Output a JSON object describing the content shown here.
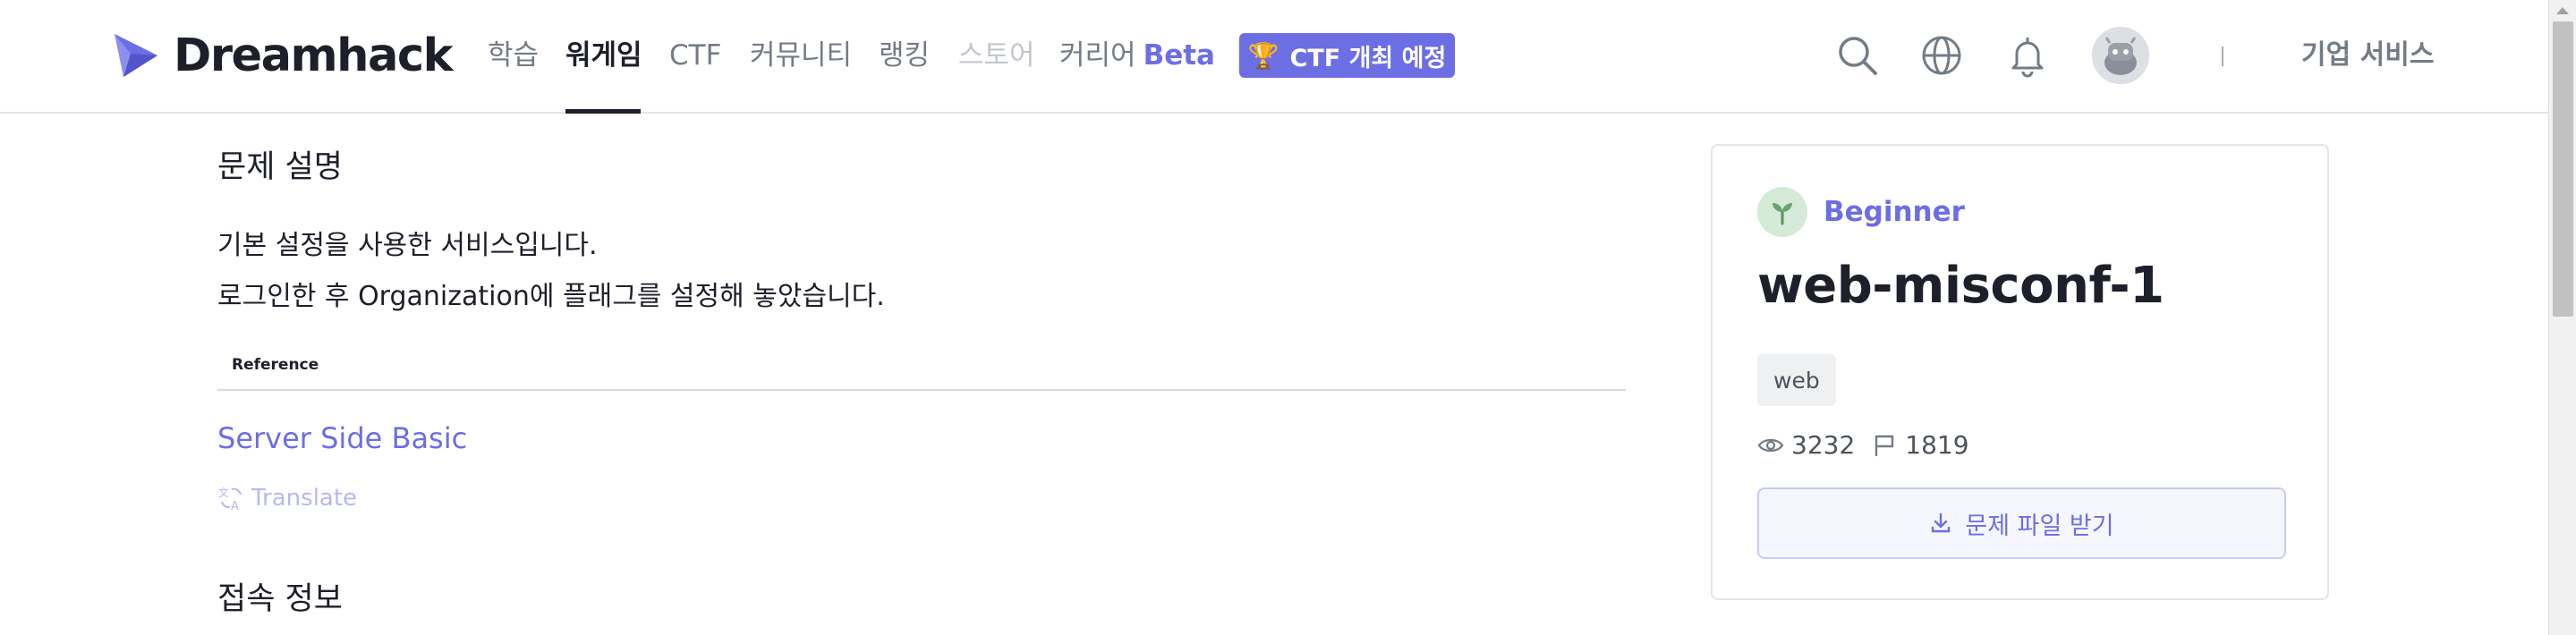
{
  "header": {
    "logo_text": "Dreamhack",
    "nav": [
      {
        "label": "학습"
      },
      {
        "label": "워게임"
      },
      {
        "label": "CTF"
      },
      {
        "label": "커뮤니티"
      },
      {
        "label": "랭킹"
      },
      {
        "label": "스토어"
      },
      {
        "label": "커리어",
        "badge": "Beta"
      }
    ],
    "ctf_badge": "CTF 개최 예정",
    "biz_label": "기업 서비스",
    "icons": [
      "search-icon",
      "globe-icon",
      "bell-icon",
      "avatar"
    ]
  },
  "content": {
    "section1_title": "문제 설명",
    "description": [
      "기본 설정을 사용한 서비스입니다.",
      "로그인한 후 Organization에 플래그를 설정해 놓았습니다."
    ],
    "reference_label": "Reference",
    "reference_link": "Server Side Basic",
    "translate_label": "Translate",
    "section2_title": "접속 정보"
  },
  "card": {
    "level": "Beginner",
    "title": "web-misconf-1",
    "tag": "web",
    "views": "3232",
    "solves": "1819",
    "download_label": "문제 파일 받기"
  },
  "colors": {
    "accent": "#6c6ee4",
    "text": "#1d1f2a",
    "muted": "#737b86",
    "level_bg": "#d5ead7"
  }
}
